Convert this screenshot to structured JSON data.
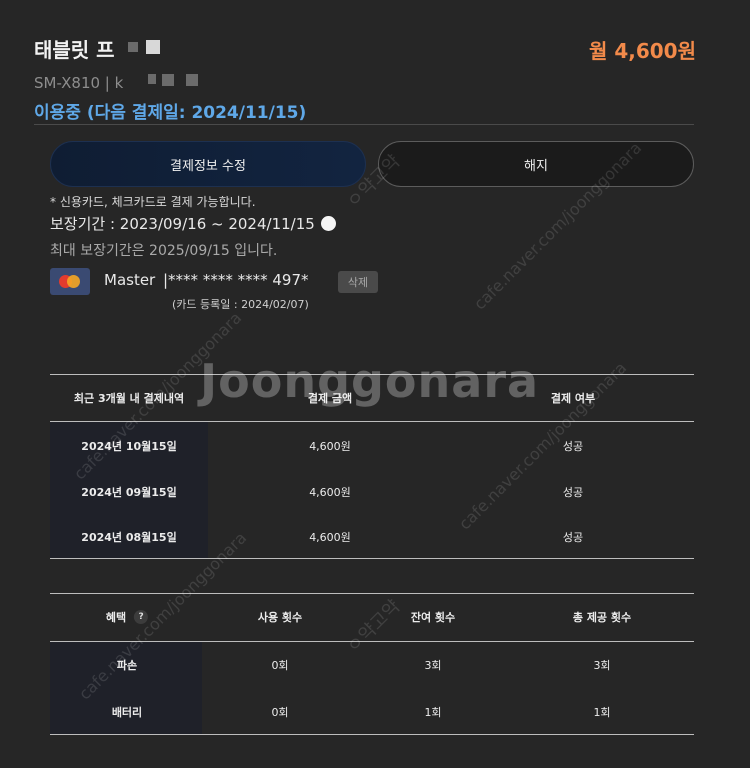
{
  "header": {
    "title": "태블릿 프",
    "price": "월 4,600원",
    "model": "SM-X810 | k",
    "status": "이용중 (다음 결제일: 2024/11/15)"
  },
  "actions": {
    "edit_label": "결제정보 수정",
    "cancel_label": "해지"
  },
  "payment_info": {
    "note": "* 신용카드, 체크카드로 결제 가능합니다.",
    "period": "보장기간 : 2023/09/16 ~ 2024/11/15",
    "max_period": "최대 보장기간은 2025/09/15 입니다.",
    "card_brand": "Master",
    "card_number": "|**** **** **** 497*",
    "delete_label": "삭제",
    "card_registered": "(카드 등록일 : 2024/02/07)"
  },
  "history_table": {
    "headers": [
      "최근 3개월 내 결제내역",
      "결제 금액",
      "결제 여부"
    ],
    "rows": [
      [
        "2024년 10월15일",
        "4,600원",
        "성공"
      ],
      [
        "2024년 09월15일",
        "4,600원",
        "성공"
      ],
      [
        "2024년 08월15일",
        "4,600원",
        "성공"
      ]
    ]
  },
  "benefit_table": {
    "headers": [
      "혜택",
      "사용 횟수",
      "잔여 횟수",
      "총 제공 횟수"
    ],
    "help_label": "?",
    "rows": [
      [
        "파손",
        "0회",
        "3회",
        "3회"
      ],
      [
        "배터리",
        "0회",
        "1회",
        "1회"
      ]
    ]
  },
  "watermark": {
    "text": "Joonggonara",
    "small": "cafe.naver.com/joonggonara",
    "stamp": "ㅇ약고약"
  }
}
